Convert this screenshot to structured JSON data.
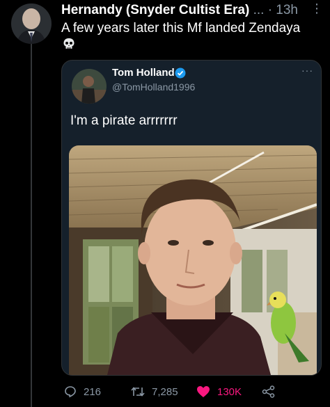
{
  "tweet": {
    "author_name": "Hernandy (Snyder Cultist Era)",
    "truncation": "...",
    "separator": "·",
    "time": "13h",
    "more_label": "⋮",
    "text": "A few years later this Mf landed Zendaya",
    "emoji_icon": "skull-emoji-icon"
  },
  "quoted": {
    "name": "Tom Holland",
    "handle": "@TomHolland1996",
    "more_label": "···",
    "text": "I'm a pirate arrrrrrr",
    "verified_color": "#1d9bf0"
  },
  "actions": {
    "replies": "216",
    "retweets": "7,285",
    "likes": "130K",
    "like_color": "#f91880"
  }
}
